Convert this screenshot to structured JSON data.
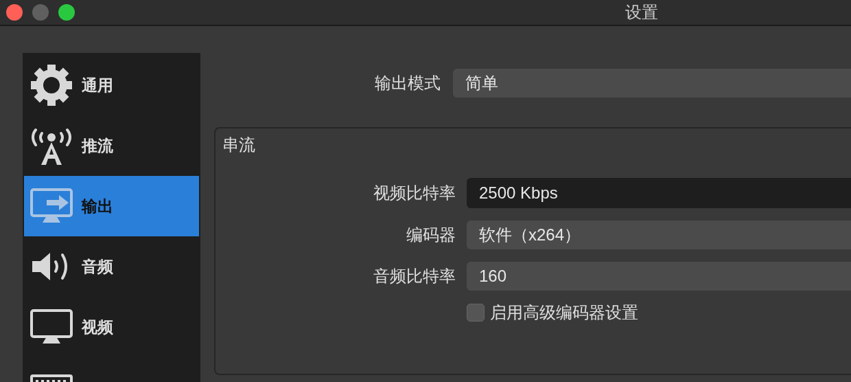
{
  "window": {
    "title": "设置",
    "buttons": [
      {
        "color": "#fe5f57"
      },
      {
        "color": "#5f5f5f"
      },
      {
        "color": "#29c840"
      }
    ]
  },
  "sidebar": {
    "items": [
      {
        "label": "通用",
        "selected": false
      },
      {
        "label": "推流",
        "selected": false
      },
      {
        "label": "输出",
        "selected": true
      },
      {
        "label": "音频",
        "selected": false
      },
      {
        "label": "视频",
        "selected": false
      },
      {
        "selected": false
      }
    ]
  },
  "output_mode": {
    "label": "输出模式",
    "value": "简单"
  },
  "group": {
    "title": "串流",
    "rows": [
      {
        "kind": "input",
        "label": "视频比特率",
        "value": "2500 Kbps"
      },
      {
        "kind": "select",
        "label": "编码器",
        "value": "软件（x264）"
      },
      {
        "kind": "select",
        "label": "音频比特率",
        "value": "160"
      }
    ],
    "checkbox": {
      "label": "启用高级编码器设置",
      "checked": false
    }
  }
}
